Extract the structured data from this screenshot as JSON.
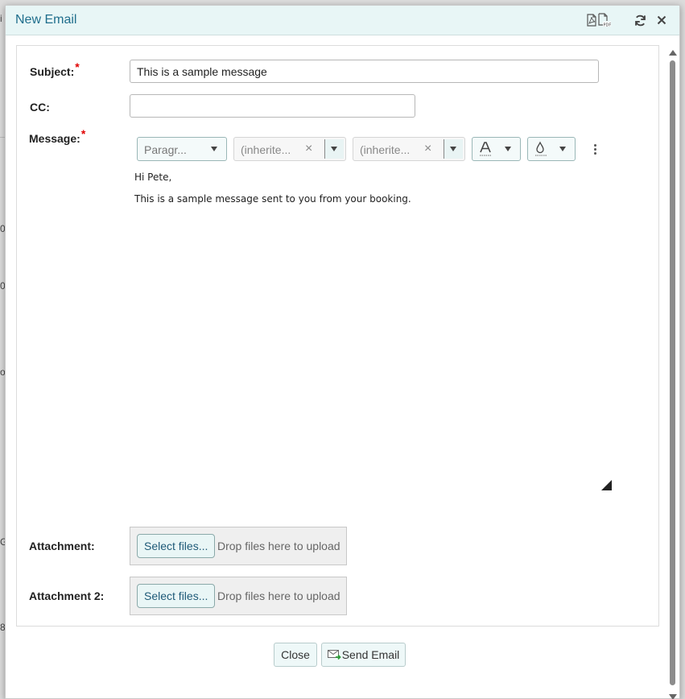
{
  "background": {
    "peek_glyphs": [
      "i",
      "0",
      "0",
      "o",
      "G",
      "8"
    ]
  },
  "dialog": {
    "title": "New Email",
    "icons": {
      "pdf_1": "pdf-file-icon",
      "pdf_2": "pdf-export-icon",
      "refresh": "refresh-icon",
      "close": "close-icon"
    }
  },
  "form": {
    "subject": {
      "label": "Subject:",
      "required_mark": "*",
      "value": "This is a sample message"
    },
    "cc": {
      "label": "CC:",
      "value": ""
    },
    "message": {
      "label": "Message:",
      "required_mark": "*",
      "toolbar": {
        "format": "Paragr...",
        "font_family": "(inherite...",
        "font_size": "(inherite...",
        "font_family_clear": "×",
        "font_size_clear": "×"
      },
      "body": [
        "Hi Pete,",
        "This is a sample message sent to you from your booking."
      ]
    },
    "attachment_1": {
      "label": "Attachment:",
      "button": "Select files...",
      "hint": "Drop files here to upload"
    },
    "attachment_2": {
      "label": "Attachment 2:",
      "button": "Select files...",
      "hint": "Drop files here to upload"
    }
  },
  "footer": {
    "close_label": "Close",
    "send_label": "Send Email"
  },
  "colors": {
    "title": "#1f6e8c",
    "titlebar_bg": "#e8f6f6",
    "required": "#e00000"
  }
}
